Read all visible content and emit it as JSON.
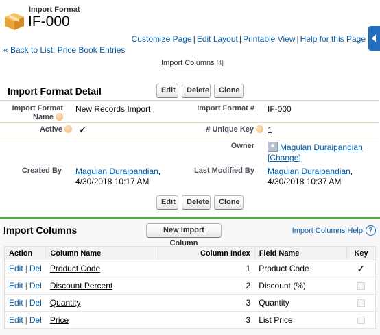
{
  "header": {
    "object_icon": "package-box-icon",
    "object_type": "Import Format",
    "record_name": "IF-000",
    "links": [
      "Customize Page",
      "Edit Layout",
      "Printable View",
      "Help for this Page"
    ],
    "back_link": "« Back to List: Price Book Entries",
    "related_link": {
      "label": "Import Columns",
      "count": "[4]"
    }
  },
  "detail": {
    "title": "Import Format Detail",
    "buttons": {
      "edit": "Edit",
      "delete": "Delete",
      "clone": "Clone"
    },
    "fields": {
      "name_label": "Import Format Name",
      "name_value": "New Records Import",
      "number_label": "Import Format #",
      "number_value": "IF-000",
      "active_label": "Active",
      "active_value": "✓",
      "unique_key_label": "# Unique Key",
      "unique_key_value": "1",
      "owner_label": "Owner",
      "owner_name": "Magulan Duraipandian",
      "owner_change": "[Change]",
      "created_label": "Created By",
      "created_by": "Magulan Duraipandian",
      "created_date": "4/30/2018 10:17 AM",
      "modified_label": "Last Modified By",
      "modified_by": "Magulan Duraipandian",
      "modified_date": "4/30/2018 10:37 AM"
    }
  },
  "related_list": {
    "title": "Import Columns",
    "new_button": "New Import Column",
    "help_link": "Import Columns Help",
    "help_icon": "?",
    "columns": [
      "Action",
      "Column Name",
      "Column Index",
      "Field Name",
      "Key"
    ],
    "action_edit": "Edit",
    "action_del": "Del",
    "rows": [
      {
        "column_name": "Product Code",
        "index": "1",
        "field_name": "Product Code",
        "key": true
      },
      {
        "column_name": "Discount Percent",
        "index": "2",
        "field_name": "Discount (%)",
        "key": false
      },
      {
        "column_name": "Quantity",
        "index": "3",
        "field_name": "Quantity",
        "key": false
      },
      {
        "column_name": "Price",
        "index": "3",
        "field_name": "List Price",
        "key": false
      }
    ]
  },
  "colors": {
    "accent": "#56a64a",
    "link": "#015ba7",
    "sidebar_tab": "#236fbd"
  }
}
